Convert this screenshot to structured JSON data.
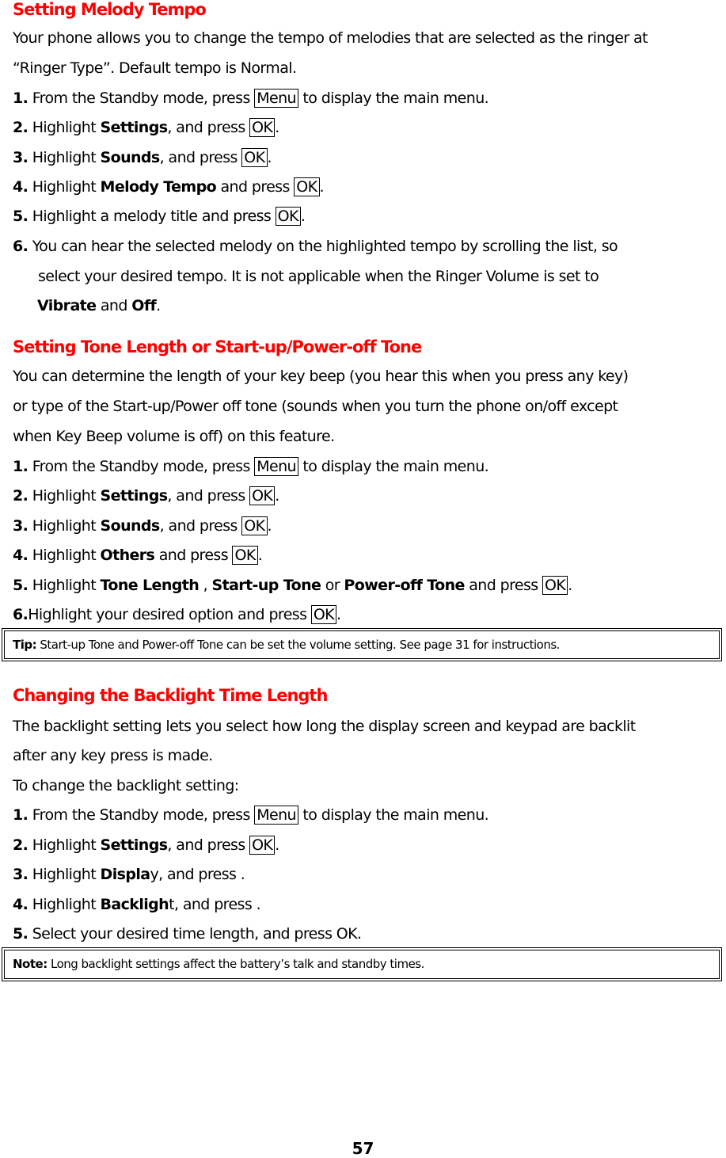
{
  "section1": {
    "title": "Setting Melody Tempo",
    "intro1": "Your phone allows you to change the tempo of melodies that are selected as the ringer at",
    "intro2": "“Ringer Type”. Default tempo is Normal.",
    "steps": [
      {
        "n": "1.",
        "a": "From the Standby mode, press ",
        "key": "Menu",
        "b": " to display the main menu."
      },
      {
        "n": "2.",
        "a": "Highlight ",
        "bold": "Settings",
        "c": ", and press ",
        "key": "OK",
        "d": "."
      },
      {
        "n": "3.",
        "a": "Highlight ",
        "bold": "Sounds",
        "c": ", and press ",
        "key": "OK",
        "d": "."
      },
      {
        "n": "4.",
        "a": "Highlight ",
        "bold": "Melody Tempo",
        "c": " and press ",
        "key": "OK",
        "d": "."
      },
      {
        "n": "5.",
        "a": "Highlight a melody title and press ",
        "key": "OK",
        "d": "."
      },
      {
        "n": "6.",
        "a": "You can hear the selected melody on the highlighted tempo by scrolling the list, so"
      }
    ],
    "step6_cont": "select your desired tempo. It is not applicable when the Ringer Volume is set to",
    "step6_b1": "Vibrate",
    "step6_and": " and ",
    "step6_b2": "Off",
    "step6_end": "."
  },
  "section2": {
    "title": "Setting Tone Length or Start-up/Power-off Tone",
    "intro1": "You can determine the length of your key beep (you hear this when you press any key)",
    "intro2": "or type of the Start-up/Power off tone (sounds when you turn the phone on/off except",
    "intro3": "when Key Beep volume is off) on this feature.",
    "steps": [
      {
        "n": "1.",
        "a": "From the Standby mode, press ",
        "key": "Menu",
        "b": " to display the main menu."
      },
      {
        "n": "2.",
        "a": "Highlight ",
        "bold": "Settings",
        "c": ", and press ",
        "key": "OK",
        "d": "."
      },
      {
        "n": "3.",
        "a": "Highlight ",
        "bold": "Sounds",
        "c": ", and press ",
        "key": "OK",
        "d": "."
      },
      {
        "n": "4.",
        "a": "Highlight ",
        "bold": "Others",
        "c": " and press ",
        "key": "OK",
        "d": "."
      },
      {
        "n": "5.",
        "a": "Highlight ",
        "bold1": "Tone Length",
        "sep1": " , ",
        "bold2": "Start-up Tone",
        "sep2": " or ",
        "bold3": "Power-off Tone",
        "c": " and press ",
        "key": "OK",
        "d": "."
      },
      {
        "n": "6.",
        "a": "Highlight your desired option and press ",
        "key": "OK",
        "d": "."
      }
    ],
    "tip_label": "Tip:",
    "tip_text": " Start-up Tone and Power-off Tone can be set the volume setting. See page 31 for instructions."
  },
  "section3": {
    "title": "Changing the Backlight Time Length",
    "intro1": "The backlight setting lets you select how long the display screen and keypad are backlit",
    "intro2": "after any key press is made.",
    "intro3": "To change the backlight setting:",
    "steps": [
      {
        "n": "1.",
        "a": "From the Standby mode, press ",
        "key": "Menu",
        "b": " to display the main menu."
      },
      {
        "n": "2.",
        "a": "Highlight ",
        "bold": "Settings",
        "c": ", and press ",
        "key": "OK",
        "d": "."
      },
      {
        "n": "3.",
        "a": "Highlight ",
        "bold": "Displa",
        "c": "y, and press ."
      },
      {
        "n": "4.",
        "a": "Highlight ",
        "bold": "Backligh",
        "c": "t, and press ."
      },
      {
        "n": "5.",
        "a": "Select your desired time length, and press OK."
      }
    ],
    "note_label": "Note:",
    "note_text": " Long backlight settings affect the battery’s talk and standby times."
  },
  "page_number": "57"
}
